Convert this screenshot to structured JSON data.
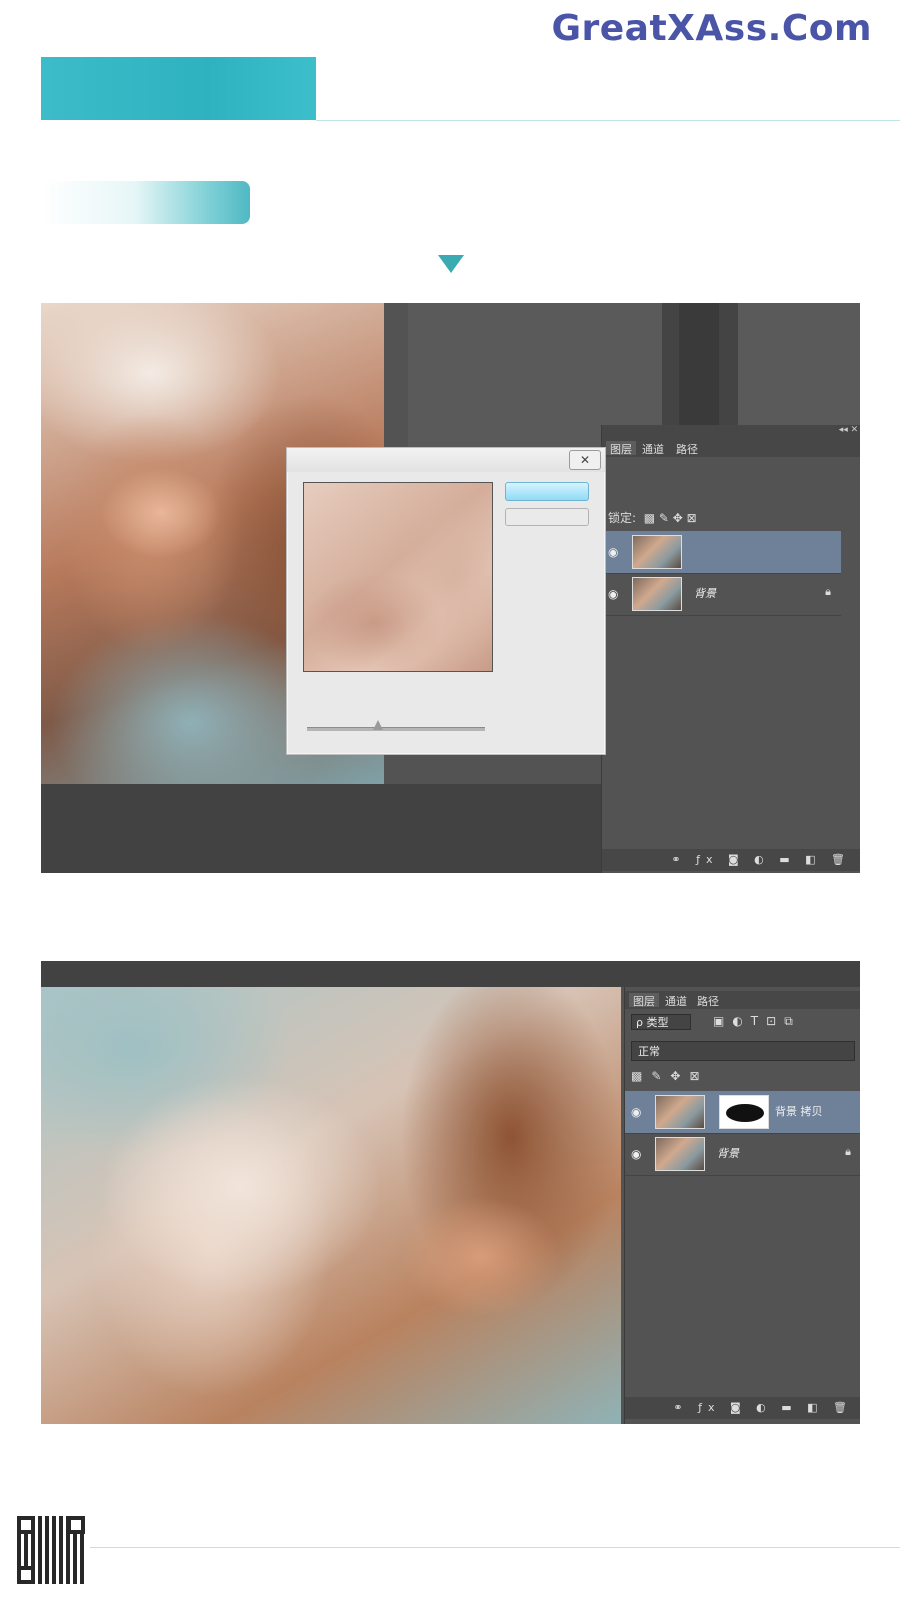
{
  "watermark": "GreatXAss.Com",
  "shot1": {
    "tabs": [
      "图层",
      "通道",
      "路径"
    ],
    "lock_label": "锁定:",
    "layers": [
      {
        "name": "",
        "selected": true
      },
      {
        "name": "背景",
        "selected": false,
        "locked": true
      }
    ],
    "dialog": {
      "close_glyph": "✕",
      "ok_label": "",
      "slider_value_fraction": 0.4
    }
  },
  "shot2": {
    "tabs": [
      "图层",
      "通道",
      "路径"
    ],
    "kind_label": "ρ 类型",
    "blend_mode": "正常",
    "layers": [
      {
        "name": "背景 拷贝",
        "selected": true,
        "has_mask": true
      },
      {
        "name": "背景",
        "selected": false,
        "locked": true
      }
    ]
  },
  "icons": {
    "eye": "eye-icon",
    "lock": "lock-icon",
    "arrow": "down-triangle-icon"
  },
  "colors": {
    "accent": "#3cbcc8",
    "watermark": "#4b55a8",
    "ps_panel": "#535353",
    "selected_layer": "#6e8199"
  }
}
